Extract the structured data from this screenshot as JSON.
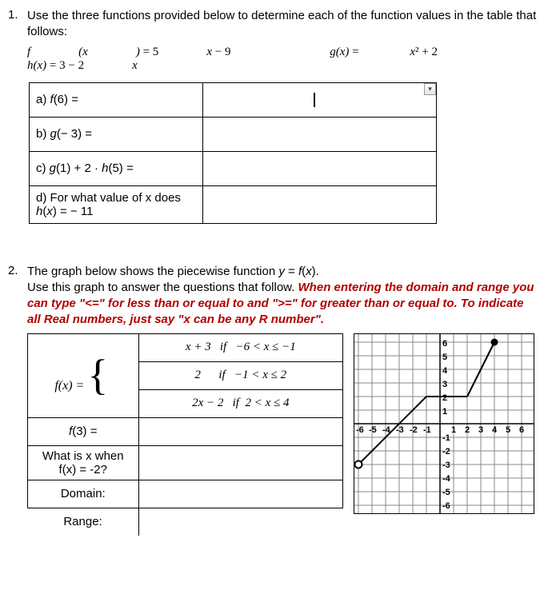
{
  "q1": {
    "number": "1.",
    "prompt": "Use the three functions provided below to determine each of the function values in the table that follows:",
    "functions": {
      "f": "f(x) = 5x − 9",
      "g": "g(x) = x² + 2",
      "h": "h(x) = 3 − 2x"
    },
    "rows": {
      "a": "a) f(6) =",
      "b": "b) g(− 3) =",
      "c": "c) g(1) + 2 · h(5) =",
      "d1": "d) For what value of x does",
      "d2": "h(x) = − 11"
    }
  },
  "q2": {
    "number": "2.",
    "prompt_plain": "The graph below shows the piecewise function y = f(x).\nUse this graph to answer the questions that follow.",
    "prompt_red": " When entering the domain and range you can type \"<=\" for less than or equal to and \">=\" for greater than or equal to. To indicate all Real numbers, just say \"x can be any R number\".",
    "piecewise_label": "f(x) =",
    "pieces": {
      "p1": "x + 3   if  − 6 < x ≤ − 1",
      "p2": "2       if  − 1 < x ≤ 2",
      "p3": "2x − 2  if  2 < x ≤ 4"
    },
    "rows": {
      "r1": "f(3) =",
      "r2a": "What is x when",
      "r2b": "f(x) = -2?",
      "r3": "Domain:",
      "r4": "Range:"
    }
  },
  "chart_data": {
    "type": "line",
    "title": "",
    "xlabel": "",
    "ylabel": "",
    "xlim": [
      -6,
      6
    ],
    "ylim": [
      -6,
      6
    ],
    "x_ticks": [
      -6,
      -5,
      -4,
      -3,
      -2,
      -1,
      1,
      2,
      3,
      4,
      5,
      6
    ],
    "y_ticks": [
      -6,
      -5,
      -4,
      -3,
      -2,
      -1,
      1,
      2,
      3,
      4,
      5,
      6
    ],
    "series": [
      {
        "name": "piece1",
        "x": [
          -6,
          -1
        ],
        "y": [
          -3,
          2
        ],
        "start_open": true,
        "end_closed": true
      },
      {
        "name": "piece2",
        "x": [
          -1,
          2
        ],
        "y": [
          2,
          2
        ],
        "start_open": true,
        "end_closed": true
      },
      {
        "name": "piece3",
        "x": [
          2,
          4
        ],
        "y": [
          2,
          6
        ],
        "start_open": true,
        "end_closed": true
      }
    ]
  }
}
